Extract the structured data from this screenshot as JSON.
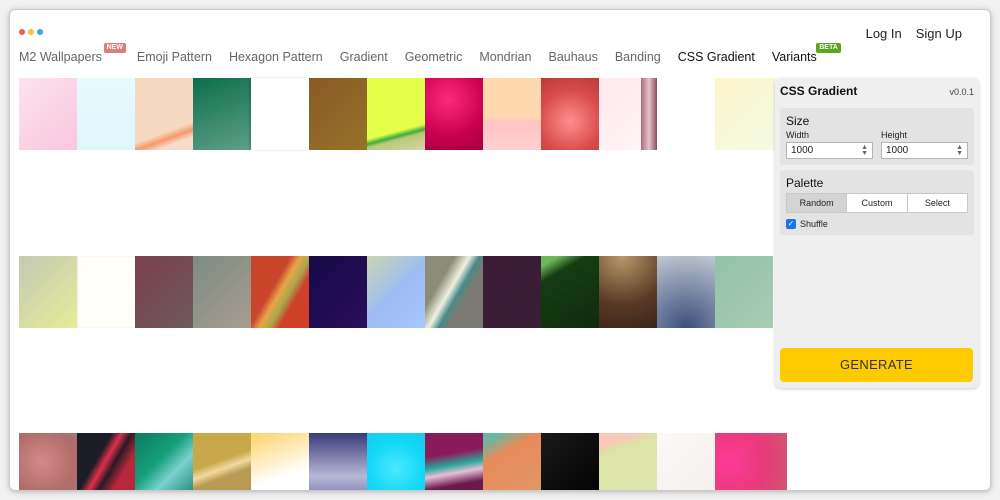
{
  "auth": {
    "login": "Log In",
    "signup": "Sign Up"
  },
  "nav": {
    "items": [
      {
        "label": "M2 Wallpapers",
        "badge": "NEW"
      },
      {
        "label": "Emoji Pattern"
      },
      {
        "label": "Hexagon Pattern"
      },
      {
        "label": "Gradient"
      },
      {
        "label": "Geometric"
      },
      {
        "label": "Mondrian"
      },
      {
        "label": "Bauhaus"
      },
      {
        "label": "Banding"
      },
      {
        "label": "CSS Gradient",
        "active": true
      },
      {
        "label": "Variants",
        "badge": "BETA"
      }
    ]
  },
  "panel": {
    "title": "CSS Gradient",
    "version": "v0.0.1",
    "size": {
      "title": "Size",
      "width_label": "Width",
      "width_value": "1000",
      "height_label": "Height",
      "height_value": "1000"
    },
    "palette": {
      "title": "Palette",
      "options": [
        "Random",
        "Custom",
        "Select"
      ],
      "selected": "Random",
      "shuffle_label": "Shuffle",
      "shuffle_checked": true
    },
    "generate_label": "GENERATE"
  },
  "colors": {
    "accent": "#fecb00",
    "check": "#1a73e8"
  }
}
